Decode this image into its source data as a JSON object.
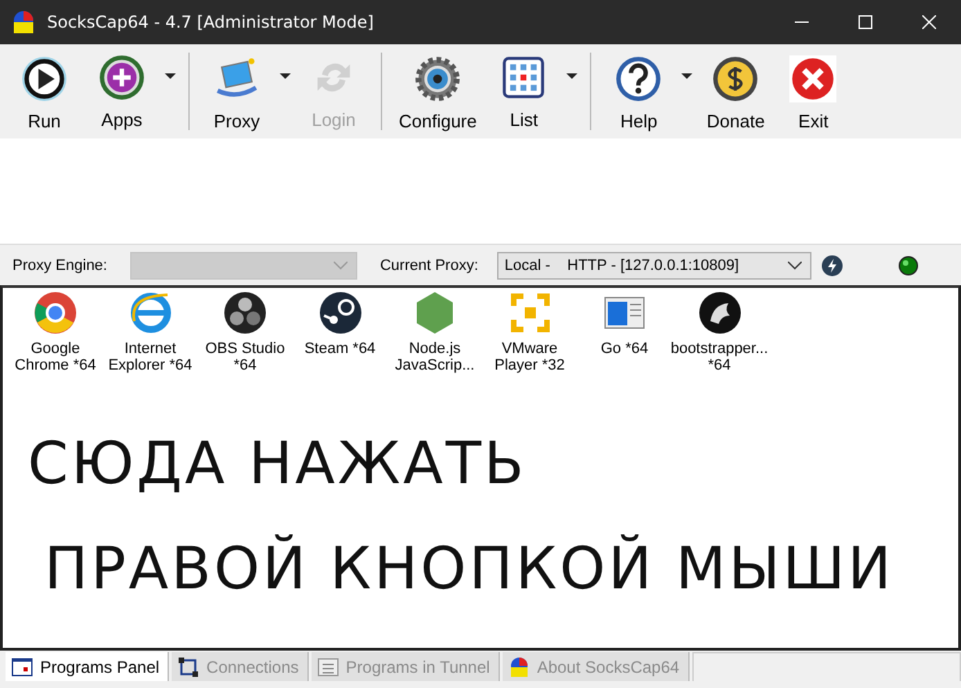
{
  "window": {
    "title": "SocksCap64 - 4.7 [Administrator Mode]"
  },
  "toolbar": [
    {
      "label": "Run",
      "dropdown": false,
      "disabled": false,
      "group_end": false
    },
    {
      "label": "Apps",
      "dropdown": true,
      "disabled": false,
      "group_end": true
    },
    {
      "label": "Proxy",
      "dropdown": true,
      "disabled": false,
      "group_end": false
    },
    {
      "label": "Login",
      "dropdown": false,
      "disabled": true,
      "group_end": true
    },
    {
      "label": "Configure",
      "dropdown": false,
      "disabled": false,
      "group_end": false
    },
    {
      "label": "List",
      "dropdown": true,
      "disabled": false,
      "group_end": true
    },
    {
      "label": "Help",
      "dropdown": true,
      "disabled": false,
      "group_end": false
    },
    {
      "label": "Donate",
      "dropdown": false,
      "disabled": false,
      "group_end": false
    },
    {
      "label": "Exit",
      "dropdown": false,
      "disabled": false,
      "group_end": false
    }
  ],
  "proxy_bar": {
    "engine_label": "Proxy Engine:",
    "engine_disabled": true,
    "current_label": "Current Proxy:",
    "current_value": "Local -    HTTP - [127.0.0.1:10809]"
  },
  "programs": [
    {
      "label": "Google Chrome *64"
    },
    {
      "label": "Internet Explorer *64"
    },
    {
      "label": "OBS Studio *64"
    },
    {
      "label": "Steam *64"
    },
    {
      "label": "Node.js JavaScrip..."
    },
    {
      "label": "VMware Player *32"
    },
    {
      "label": "Go *64"
    },
    {
      "label": "bootstrapper... *64"
    }
  ],
  "note": [
    "СЮДА НАЖАТЬ",
    "ПРАВОЙ КНОПКОЙ МЫШИ"
  ],
  "tabs": [
    {
      "label": "Programs Panel",
      "selected": true
    },
    {
      "label": "Connections",
      "selected": false
    },
    {
      "label": "Programs in Tunnel",
      "selected": false
    },
    {
      "label": "About SocksCap64",
      "selected": false
    }
  ]
}
